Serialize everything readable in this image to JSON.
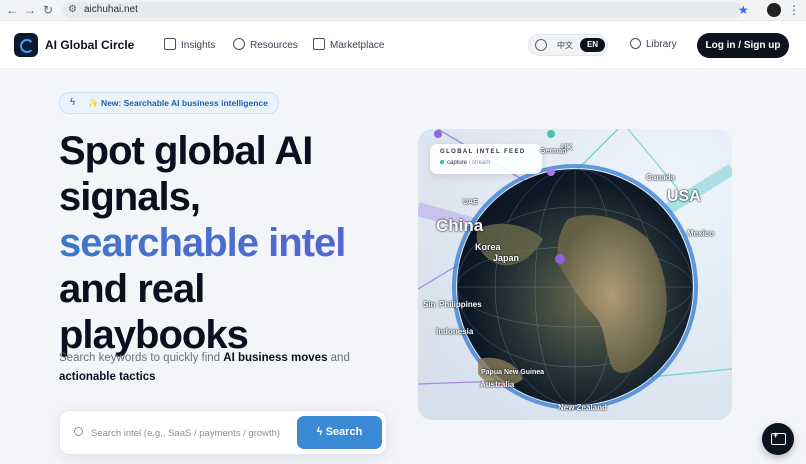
{
  "browser": {
    "url": "aichuhai.net"
  },
  "header": {
    "logo_text": "AI Global Circle",
    "nav": [
      {
        "label": "Insights",
        "icon": "grid-icon"
      },
      {
        "label": "Resources",
        "icon": "globe-icon"
      },
      {
        "label": "Marketplace",
        "icon": "store-icon"
      }
    ],
    "lang": {
      "zh": "中文",
      "en": "EN",
      "active": "EN"
    },
    "library_label": "Library",
    "login_label": "Log in / Sign up"
  },
  "hero": {
    "badge": "✨ New: Searchable AI business intelligence",
    "headline_1": "Spot global AI",
    "headline_2": "signals,",
    "headline_accent": "searchable intel",
    "headline_3": "and real",
    "headline_4": "playbooks",
    "sub_1": "Search keywords to quickly find ",
    "sub_bold_1": "AI business moves",
    "sub_2": " and ",
    "sub_bold_2": "actionable tactics"
  },
  "search": {
    "placeholder": "Search intel (e.g., SaaS / payments / growth)",
    "button_label": "Search"
  },
  "globe": {
    "feed_title": "GLOBAL INTEL FEED",
    "feed_capture": "capture",
    "feed_sep": "/",
    "feed_stream": "stream",
    "labels": {
      "china": "China",
      "korea": "Korea",
      "japan": "Japan",
      "usa": "USA",
      "canada": "Canada",
      "mexico": "Mexico",
      "uk": "UK",
      "germany": "German",
      "uae": "UAE",
      "singapore": "Sin",
      "philippines": "Philippines",
      "indonesia": "Indonesia",
      "png": "Papua New Guinea",
      "australia": "Australia",
      "nz": "New Zealand"
    }
  },
  "colors": {
    "accent": "#3a8ad6",
    "dark": "#0d1220",
    "headline_gradient_start": "#3d78c8",
    "headline_gradient_end": "#5b5fd6"
  }
}
